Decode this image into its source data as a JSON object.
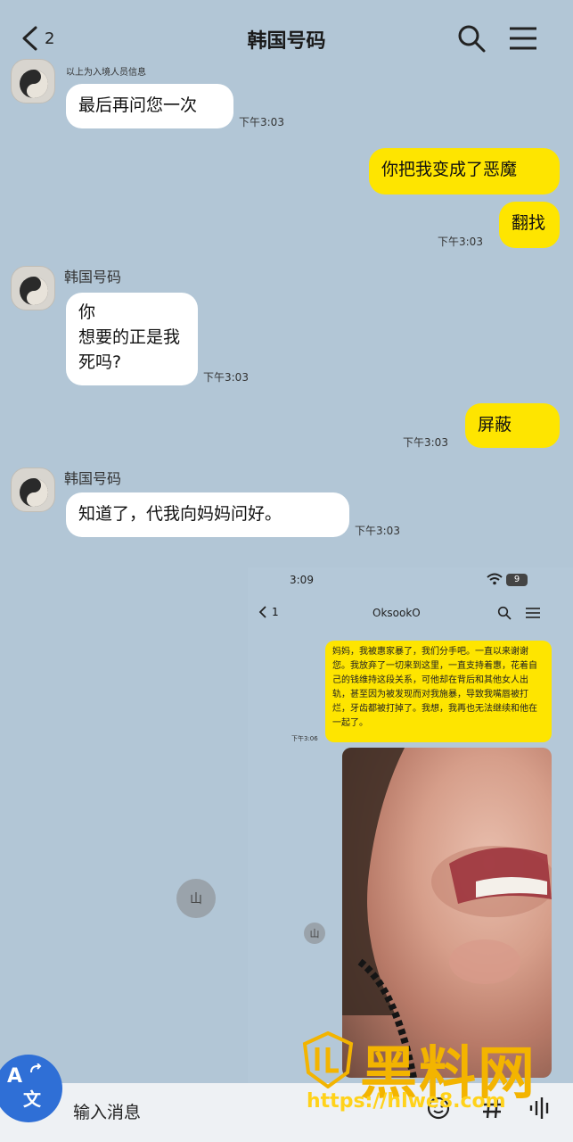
{
  "header": {
    "back_count": "2",
    "title": "韩国号码"
  },
  "messages": {
    "note_top": "以上为入境人员信息",
    "m1_text": "最后再问您一次",
    "m1_time": "下午3:03",
    "m2_text": "你把我变成了恶魔",
    "m3_text": "翻找",
    "m3_time": "下午3:03",
    "sender_name": "韩国号码",
    "m4_line1": "你",
    "m4_line2": "想要的正是我",
    "m4_line3": "死吗?",
    "m4_time": "下午3:03",
    "m5_text": "屏蔽",
    "m5_time": "下午3:03",
    "m6_text": "知道了，代我向妈妈问好。",
    "m6_time": "下午3:03"
  },
  "embedded": {
    "status_time": "3:09",
    "battery": "9",
    "back_count": "1",
    "title": "OksookO",
    "message": "妈妈，我被惠家暴了，我们分手吧。一直以来谢谢您。我放弃了一切来到这里，一直支持着惠，花着自己的钱维持这段关系，可他却在背后和其他女人出轨，甚至因为被发现而对我施暴，导致我嘴唇被打烂，牙齿都被打掉了。我想，我再也无法继续和他在一起了。",
    "message_time": "下午3:06",
    "avatar_char": "山"
  },
  "input": {
    "placeholder": "输入消息",
    "translate_glyph_a": "A",
    "translate_glyph_b": "文"
  },
  "watermark": {
    "logo_text": "黑料网",
    "url": "https://hlwe8.com"
  },
  "colors": {
    "background": "#b2c6d6",
    "my_bubble": "#fee500",
    "their_bubble": "#ffffff",
    "translate_button": "#2f6fd6"
  }
}
